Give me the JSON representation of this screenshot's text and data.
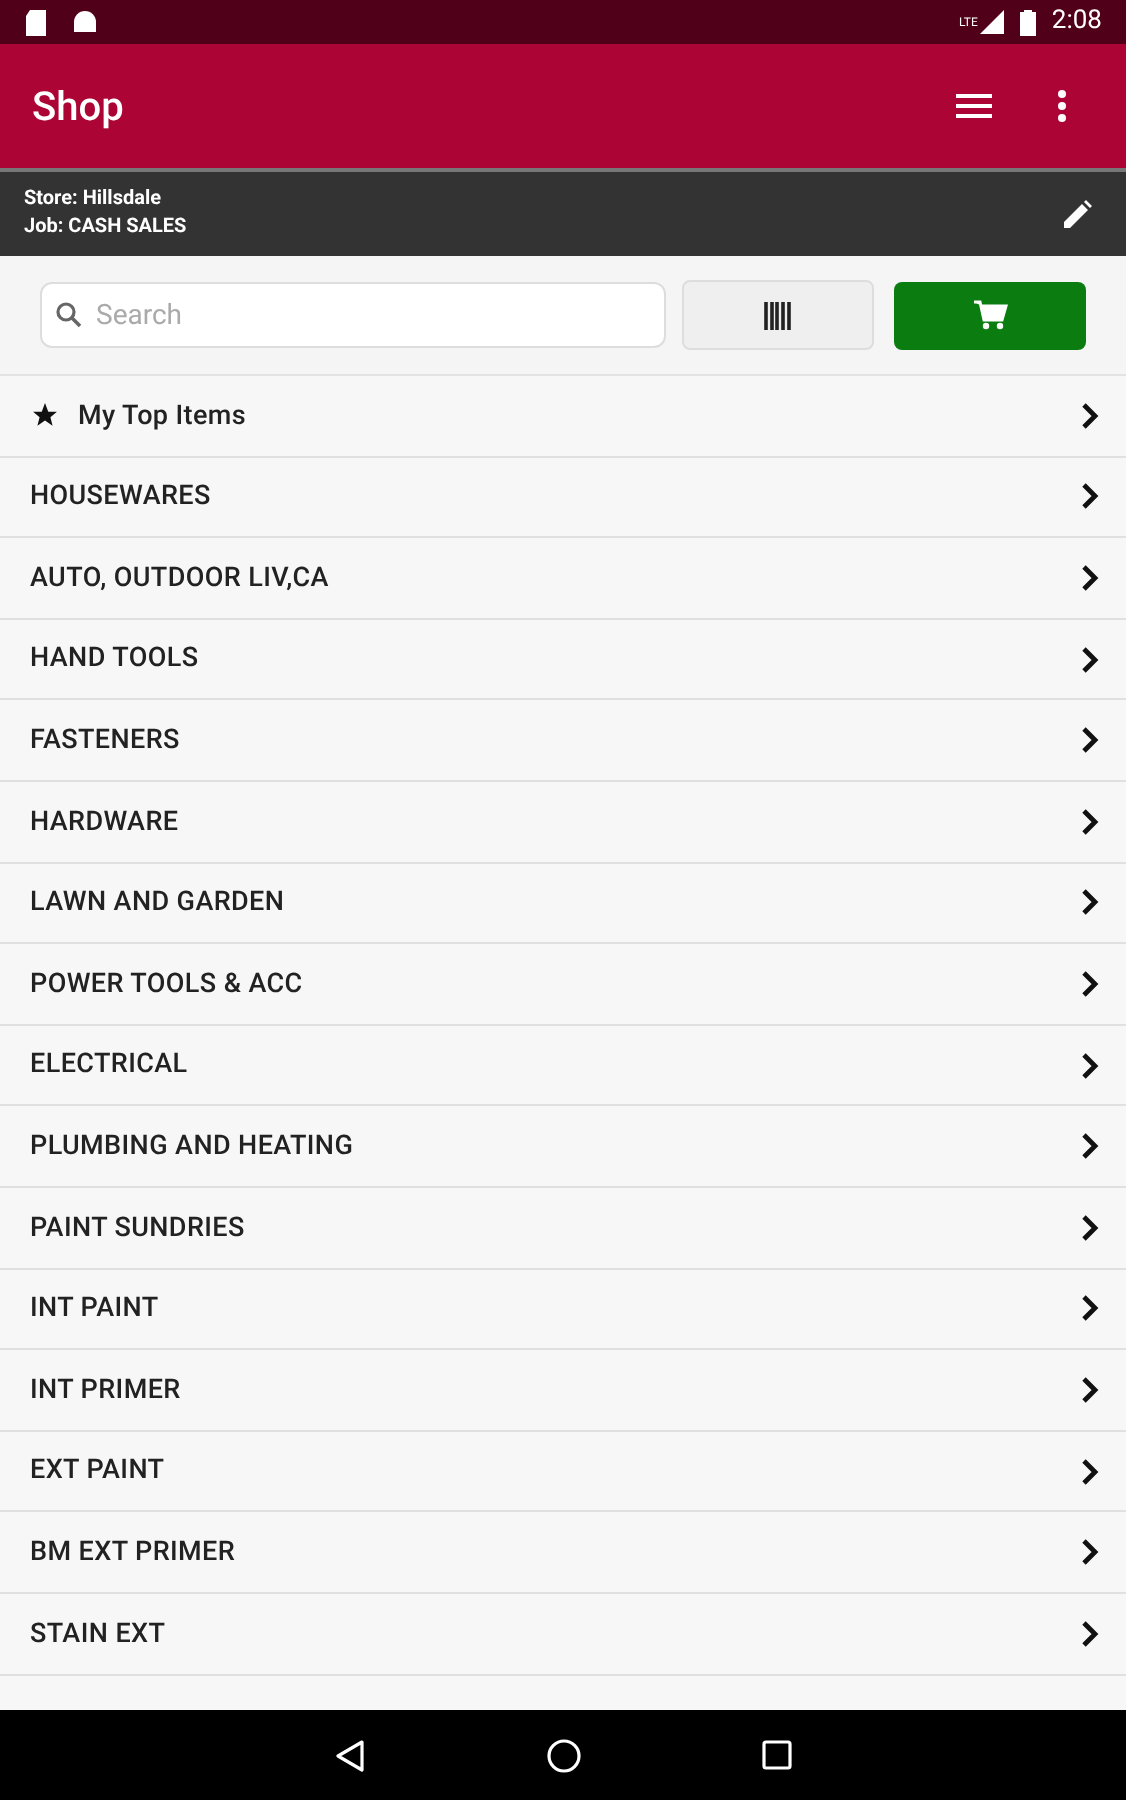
{
  "status_bar": {
    "time": "2:08",
    "network": "LTE"
  },
  "app_bar": {
    "title": "Shop"
  },
  "info_bar": {
    "store": "Store: Hillsdale",
    "job": "Job: CASH SALES"
  },
  "search": {
    "placeholder": "Search"
  },
  "categories": [
    {
      "label": "My Top Items",
      "kind": "favorite"
    },
    {
      "label": "HOUSEWARES",
      "kind": "category"
    },
    {
      "label": "AUTO, OUTDOOR LIV,CA",
      "kind": "category"
    },
    {
      "label": "HAND TOOLS",
      "kind": "category"
    },
    {
      "label": "FASTENERS",
      "kind": "category"
    },
    {
      "label": "HARDWARE",
      "kind": "category"
    },
    {
      "label": "LAWN AND GARDEN",
      "kind": "category"
    },
    {
      "label": "POWER TOOLS & ACC",
      "kind": "category"
    },
    {
      "label": "ELECTRICAL",
      "kind": "category"
    },
    {
      "label": "PLUMBING AND HEATING",
      "kind": "category"
    },
    {
      "label": "PAINT SUNDRIES",
      "kind": "category"
    },
    {
      "label": "INT PAINT",
      "kind": "category"
    },
    {
      "label": "INT PRIMER",
      "kind": "category"
    },
    {
      "label": "EXT PAINT",
      "kind": "category"
    },
    {
      "label": "BM EXT PRIMER",
      "kind": "category"
    },
    {
      "label": "STAIN EXT",
      "kind": "category"
    }
  ]
}
